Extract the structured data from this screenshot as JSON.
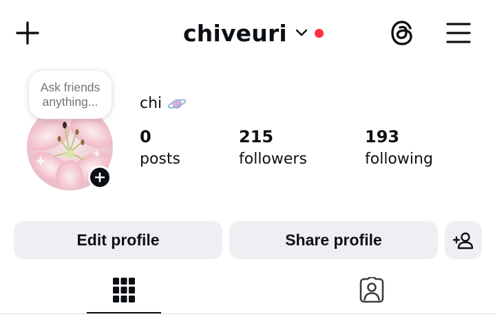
{
  "header": {
    "add_icon": "plus-icon",
    "username": "chiveuri",
    "switch_account_icon": "chevron-down-icon",
    "notification_dot_color": "#ff3040",
    "threads_icon": "threads-icon",
    "menu_icon": "hamburger-menu-icon"
  },
  "profile": {
    "note_line1": "Ask friends",
    "note_line2": "anything...",
    "display_name": "chi",
    "name_emoji_icon": "ringed-planet-icon",
    "avatar": "pink-lily-flower-photo",
    "avatar_add_icon": "plus-icon",
    "stats": [
      {
        "value": "0",
        "label": "posts"
      },
      {
        "value": "215",
        "label": "followers"
      },
      {
        "value": "193",
        "label": "following"
      }
    ]
  },
  "actions": {
    "edit_label": "Edit profile",
    "share_label": "Share profile",
    "discover_icon": "add-person-icon"
  },
  "tabs": [
    {
      "name": "grid",
      "icon": "grid-icon",
      "active": true
    },
    {
      "name": "tagged",
      "icon": "tagged-person-icon",
      "active": false
    }
  ],
  "colors": {
    "text": "#0c1014",
    "button_bg": "#efeff3",
    "muted_text": "#737373",
    "divider": "#dbdbdb"
  }
}
